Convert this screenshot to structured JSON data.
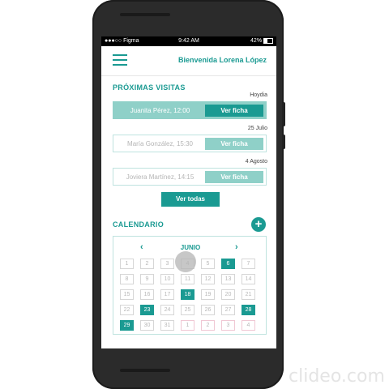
{
  "status_bar": {
    "carrier": "●●●○○ Figma",
    "time": "9:42 AM",
    "battery": "42%"
  },
  "header": {
    "welcome": "Bienvenida Lorena López"
  },
  "upcoming": {
    "title": "PRÓXIMAS VISITAS",
    "visits": [
      {
        "date": "Hoydia",
        "name": "Juanita Pérez, 12:00",
        "button": "Ver ficha"
      },
      {
        "date": "25 Julio",
        "name": "María González, 15:30",
        "button": "Ver ficha"
      },
      {
        "date": "4 Agosto",
        "name": "Joviera Martínez, 14:15",
        "button": "Ver ficha"
      }
    ],
    "see_all": "Ver todas"
  },
  "calendar": {
    "title": "CALENDARIO",
    "add_label": "+",
    "month": "JUNIO",
    "prev": "‹",
    "next": "›",
    "days": [
      "1",
      "2",
      "3",
      "4",
      "5",
      "6",
      "7",
      "8",
      "9",
      "10",
      "11",
      "12",
      "13",
      "14",
      "15",
      "16",
      "17",
      "18",
      "19",
      "20",
      "21",
      "22",
      "23",
      "24",
      "25",
      "26",
      "27",
      "28",
      "29",
      "30",
      "31",
      "1",
      "2",
      "3",
      "4"
    ],
    "selected": [
      "6",
      "18",
      "23",
      "28",
      "29"
    ]
  },
  "watermark": "clideo.com",
  "colors": {
    "accent": "#1a9a92",
    "accent_light": "#8fd0c8"
  }
}
